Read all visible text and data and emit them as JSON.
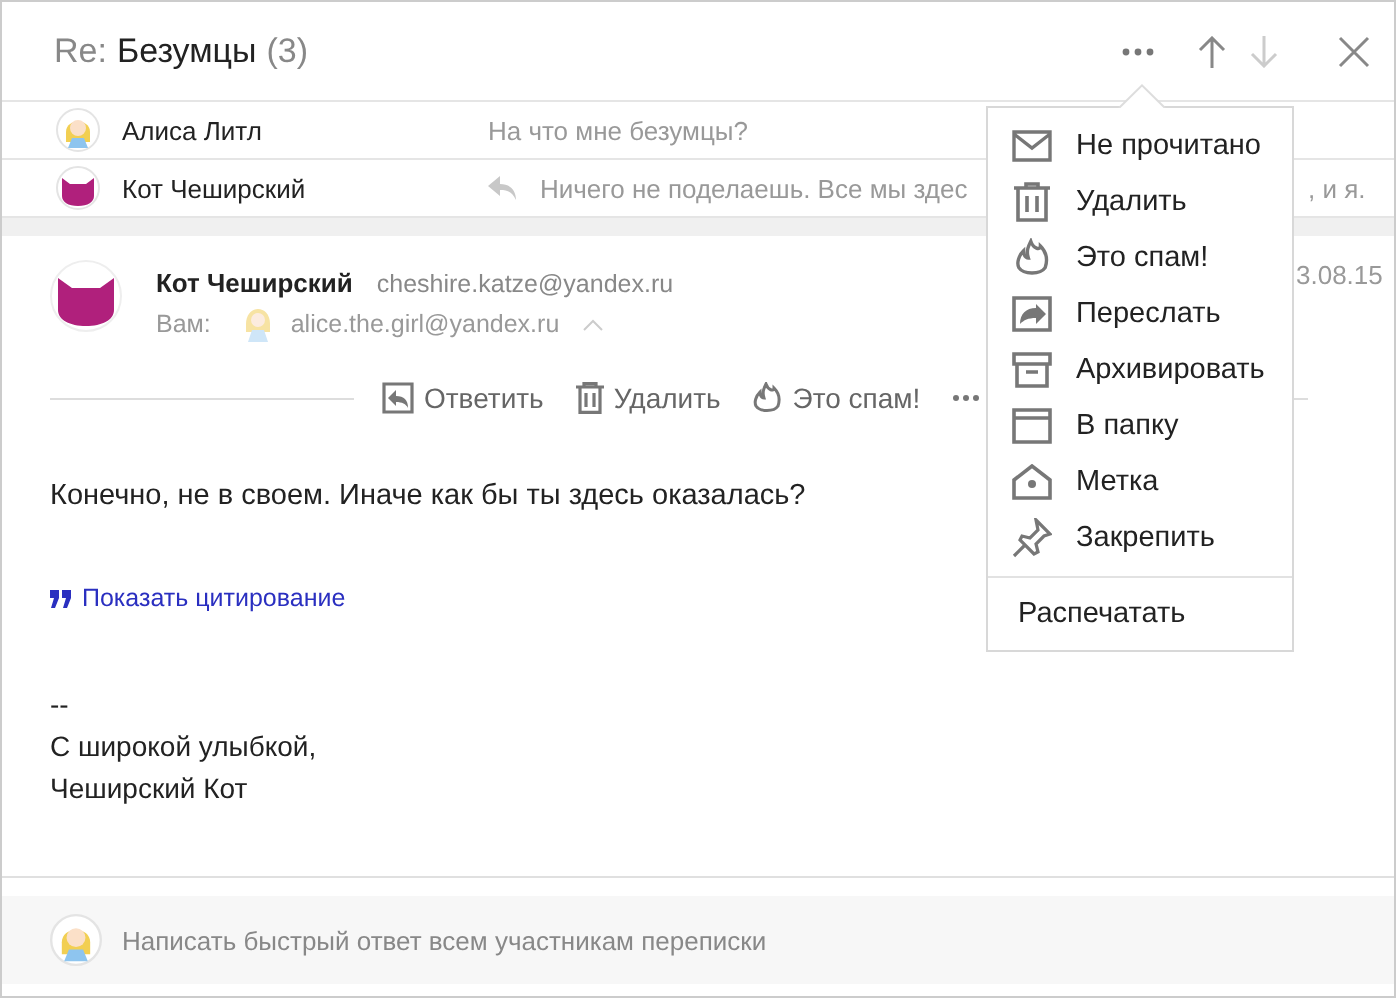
{
  "header": {
    "prefix": "Re:",
    "subject": "Безумцы",
    "count": "(3)",
    "nav": [
      {
        "kind": "up",
        "disabled": false
      },
      {
        "kind": "down",
        "disabled": true
      }
    ]
  },
  "thread": [
    {
      "kind": "girl",
      "name": "Алиса Литл",
      "replied": false,
      "preview": "На что мне безумцы?"
    },
    {
      "kind": "cat",
      "name": "Кот Чеширский",
      "replied": true,
      "preview": "Ничего не поделаешь. Все мы здес",
      "preview_tail": ", и я."
    }
  ],
  "message": {
    "from_name": "Кот Чеширский",
    "from_email": "cheshire.katze@yandex.ru",
    "to_label": "Вам:",
    "to_email": "alice.the.girl@yandex.ru",
    "date": "3.08.15",
    "actions": [
      {
        "kind": "reply",
        "label": "Ответить"
      },
      {
        "kind": "trash",
        "label": "Удалить"
      },
      {
        "kind": "fire",
        "label": "Это спам!"
      }
    ],
    "body": "Конечно, не в своем. Иначе как бы ты здесь оказалась?",
    "quote_link": "Показать цитирование",
    "signature": [
      "--",
      "С широкой улыбкой,",
      "Чеширский Кот"
    ]
  },
  "menu": {
    "items": [
      {
        "kind": "envelope",
        "label": "Не прочитано"
      },
      {
        "kind": "trash",
        "label": "Удалить"
      },
      {
        "kind": "fire",
        "label": "Это спам!"
      },
      {
        "kind": "forward",
        "label": "Переслать"
      },
      {
        "kind": "archive",
        "label": "Архивировать"
      },
      {
        "kind": "folder",
        "label": "В папку"
      },
      {
        "kind": "tag",
        "label": "Метка"
      },
      {
        "kind": "pin",
        "label": "Закрепить"
      }
    ],
    "footer_items": [
      {
        "label": "Распечатать"
      }
    ]
  },
  "quick_reply": {
    "placeholder": "Написать быстрый ответ всем участникам переписки"
  }
}
